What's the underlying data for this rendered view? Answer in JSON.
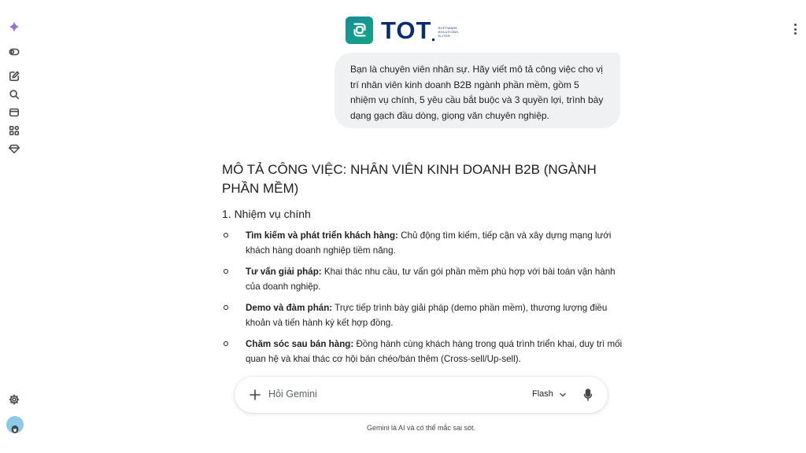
{
  "rail": {
    "items": [
      "gemini-spark-icon",
      "toggle-sidebar-icon",
      "new-chat-icon",
      "search-icon",
      "gems-icon",
      "apps-icon",
      "diamond-icon"
    ],
    "bottom": [
      "settings-icon",
      "avatar"
    ]
  },
  "header": {
    "logo_text": "TOT",
    "logo_sub": "SOFTWARE SOLUTIONS ELITES",
    "brand_color": "#0b2d6b",
    "logo_gradient": [
      "#1a8a9a",
      "#12a584"
    ]
  },
  "user_message": "Bạn là chuyên viên nhân sự. Hãy viết mô tả công việc cho vị trí nhân viên kinh doanh B2B ngành phần mềm, gồm 5 nhiệm vụ chính, 5 yêu cầu bắt buộc và 3 quyền lợi, trình bày dạng gạch đầu dòng, giọng văn chuyên nghiệp.",
  "response": {
    "title": "MÔ TẢ CÔNG VIỆC: NHÂN VIÊN KINH DOANH B2B (NGÀNH PHẦN MỀM)",
    "section1": "1. Nhiệm vụ chính",
    "items": [
      {
        "bold": "Tìm kiếm và phát triển khách hàng:",
        "text": " Chủ động tìm kiếm, tiếp cận và xây dựng mạng lưới khách hàng doanh nghiệp tiềm năng."
      },
      {
        "bold": "Tư vấn giải pháp:",
        "text": " Khai thác nhu cầu, tư vấn gói phần mềm phù hợp với bài toán vận hành của doanh nghiệp."
      },
      {
        "bold": "Demo và đàm phán:",
        "text": " Trực tiếp trình bày giải pháp (demo phần mềm), thương lượng điều khoản và tiến hành ký kết hợp đồng."
      },
      {
        "bold": "Chăm sóc sau bán hàng:",
        "text": " Đồng hành cùng khách hàng trong quá trình triển khai, duy trì mối quan hệ và khai thác cơ hội bán chéo/bán thêm (Cross-sell/Up-sell)."
      }
    ]
  },
  "input": {
    "placeholder": "Hỏi Gemini",
    "model": "Flash"
  },
  "disclaimer": "Gemini là AI và có thể mắc sai sót."
}
